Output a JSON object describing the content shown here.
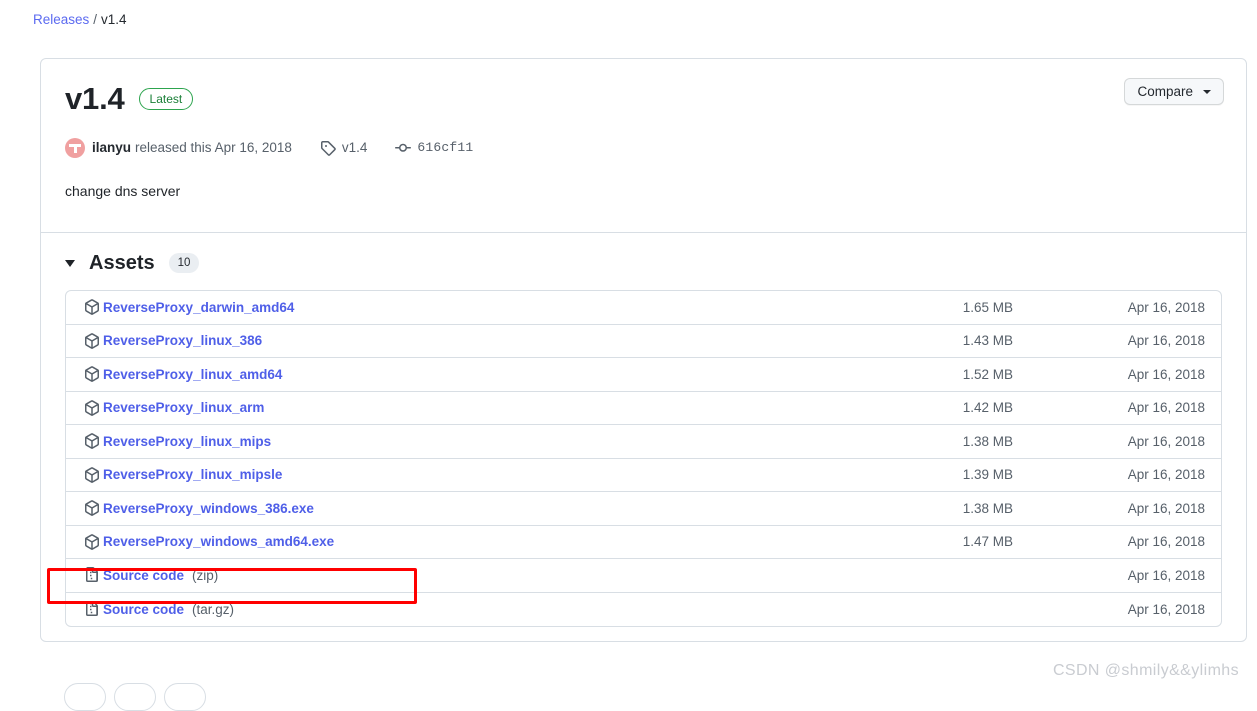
{
  "breadcrumb": {
    "root_label": "Releases",
    "separator": "/",
    "current_label": "v1.4"
  },
  "release": {
    "title": "v1.4",
    "latest_badge": "Latest",
    "compare_button": "Compare",
    "author": "ilanyu",
    "released_text": "released this Apr 16, 2018",
    "tag_name": "v1.4",
    "commit_sha": "616cf11",
    "body": "change dns server"
  },
  "assets": {
    "heading": "Assets",
    "count": "10",
    "rows": [
      {
        "name": "ReverseProxy_darwin_amd64",
        "suffix": "",
        "icon": "package-icon",
        "size": "1.65 MB",
        "date": "Apr 16, 2018",
        "highlighted": false
      },
      {
        "name": "ReverseProxy_linux_386",
        "suffix": "",
        "icon": "package-icon",
        "size": "1.43 MB",
        "date": "Apr 16, 2018",
        "highlighted": false
      },
      {
        "name": "ReverseProxy_linux_amd64",
        "suffix": "",
        "icon": "package-icon",
        "size": "1.52 MB",
        "date": "Apr 16, 2018",
        "highlighted": false
      },
      {
        "name": "ReverseProxy_linux_arm",
        "suffix": "",
        "icon": "package-icon",
        "size": "1.42 MB",
        "date": "Apr 16, 2018",
        "highlighted": false
      },
      {
        "name": "ReverseProxy_linux_mips",
        "suffix": "",
        "icon": "package-icon",
        "size": "1.38 MB",
        "date": "Apr 16, 2018",
        "highlighted": false
      },
      {
        "name": "ReverseProxy_linux_mipsle",
        "suffix": "",
        "icon": "package-icon",
        "size": "1.39 MB",
        "date": "Apr 16, 2018",
        "highlighted": false
      },
      {
        "name": "ReverseProxy_windows_386.exe",
        "suffix": "",
        "icon": "package-icon",
        "size": "1.38 MB",
        "date": "Apr 16, 2018",
        "highlighted": false
      },
      {
        "name": "ReverseProxy_windows_amd64.exe",
        "suffix": "",
        "icon": "package-icon",
        "size": "1.47 MB",
        "date": "Apr 16, 2018",
        "highlighted": true
      },
      {
        "name": "Source code",
        "suffix": "(zip)",
        "icon": "file-zip-icon",
        "size": "",
        "date": "Apr 16, 2018",
        "highlighted": false
      },
      {
        "name": "Source code",
        "suffix": "(tar.gz)",
        "icon": "file-zip-icon",
        "size": "",
        "date": "Apr 16, 2018",
        "highlighted": false
      }
    ]
  },
  "watermark": "CSDN @shmily&&ylimhs",
  "colors": {
    "link": "#4f5fe8",
    "badge_green": "#1a7f37",
    "annotation_red": "#ff0000",
    "muted_text": "#57606a"
  }
}
